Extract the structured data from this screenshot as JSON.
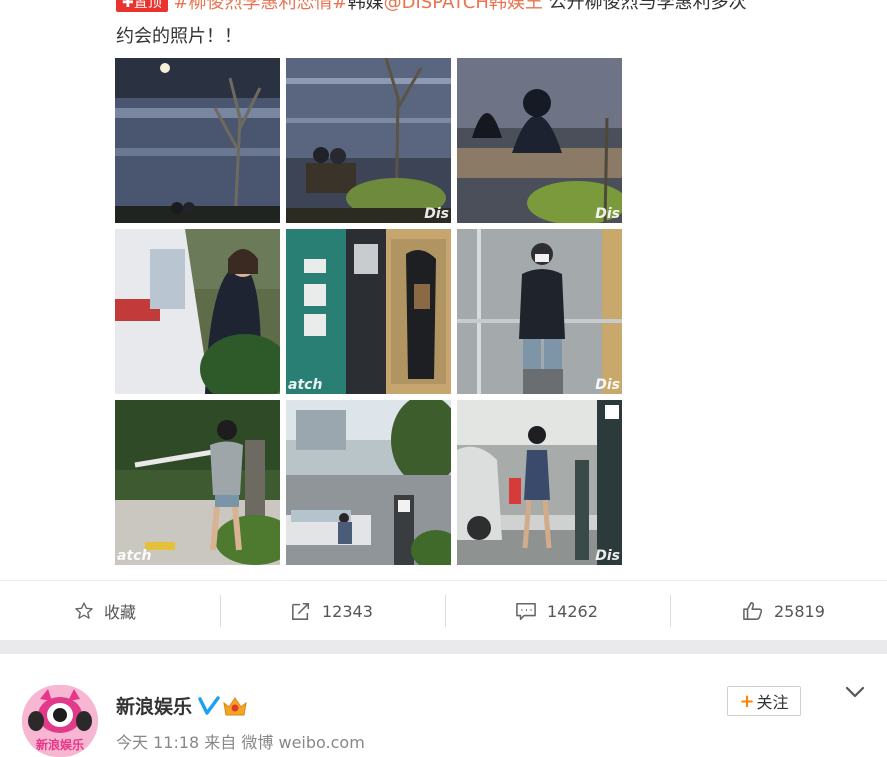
{
  "post": {
    "hot_badge": "✚置顶",
    "hashtags": "#柳俊烈李惠利恋情#",
    "source_prefix": "韩媒",
    "mention": "@DISPATCH韩娱王",
    "body_rest": "公开柳俊烈与李惠利多次",
    "body_line2": "约会的照片！！"
  },
  "photos": {
    "watermark": "Dis",
    "watermark_left": "atch"
  },
  "actions": {
    "favorite_label": "收藏",
    "repost_count": "12343",
    "comment_count": "14262",
    "like_count": "25819"
  },
  "next_post": {
    "author_name": "新浪娱乐",
    "time": "今天 11:18",
    "from_label": "来自",
    "client": "微博 weibo.com",
    "follow_label": "关注",
    "follow_plus": "+",
    "avatar_text": "新浪娱乐"
  },
  "colors": {
    "link": "#eb7350",
    "hot_badge": "#e8332e",
    "follow_plus": "#ff8200",
    "verified": "#1da1f2"
  }
}
